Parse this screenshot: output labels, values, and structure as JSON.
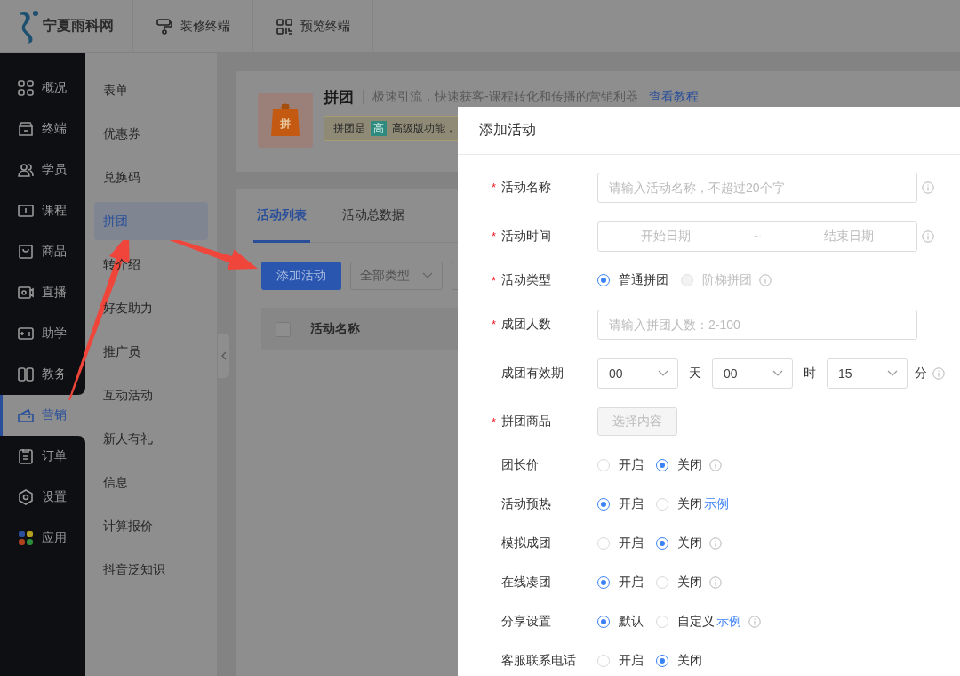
{
  "topbar": {
    "logo_text": "宁夏雨科网",
    "tabs": [
      {
        "label": "装修终端"
      },
      {
        "label": "预览终端"
      }
    ]
  },
  "nav": [
    {
      "label": "概况",
      "selected": false
    },
    {
      "label": "终端",
      "selected": false
    },
    {
      "label": "学员",
      "selected": false
    },
    {
      "label": "课程",
      "selected": false
    },
    {
      "label": "商品",
      "selected": false
    },
    {
      "label": "直播",
      "selected": false
    },
    {
      "label": "助学",
      "selected": false
    },
    {
      "label": "教务",
      "selected": false
    },
    {
      "label": "营销",
      "selected": true
    },
    {
      "label": "订单",
      "selected": false
    },
    {
      "label": "设置",
      "selected": false
    },
    {
      "label": "应用",
      "selected": false
    }
  ],
  "submenu": [
    {
      "label": "表单",
      "selected": false
    },
    {
      "label": "优惠券",
      "selected": false
    },
    {
      "label": "兑换码",
      "selected": false
    },
    {
      "label": "拼团",
      "selected": true
    },
    {
      "label": "转介绍",
      "selected": false
    },
    {
      "label": "好友助力",
      "selected": false
    },
    {
      "label": "推广员",
      "selected": false
    },
    {
      "label": "互动活动",
      "selected": false
    },
    {
      "label": "新人有礼",
      "selected": false
    },
    {
      "label": "信息",
      "selected": false
    },
    {
      "label": "计算报价",
      "selected": false
    },
    {
      "label": "抖音泛知识",
      "selected": false
    }
  ],
  "intro": {
    "icon_text": "拼",
    "title": "拼团",
    "subtitle": "极速引流，快速获客-课程转化和传播的营销利器",
    "link": "查看教程",
    "notice": {
      "prefix": "拼团是",
      "badge": "高",
      "text": "高级版功能，"
    }
  },
  "list": {
    "tabs": [
      {
        "label": "活动列表",
        "selected": true
      },
      {
        "label": "活动总数据",
        "selected": false
      }
    ],
    "add_button": "添加活动",
    "type_filter": "全部类型",
    "select_all": {
      "checked": false
    },
    "columns": [
      {
        "label": "活动名称"
      }
    ]
  },
  "drawer": {
    "title": "添加活动",
    "rows": [
      {
        "kind": "input",
        "required_mark": "*",
        "label": "活动名称",
        "placeholder": "请输入活动名称，不超过20个字",
        "info": true
      },
      {
        "kind": "daterange",
        "required_mark": "*",
        "label": "活动时间",
        "start": "开始日期",
        "sep": "~",
        "end": "结束日期",
        "info": true
      },
      {
        "kind": "radio",
        "required_mark": "*",
        "label": "活动类型",
        "options": [
          {
            "label": "普通拼团",
            "selected": true,
            "disabled": false
          },
          {
            "label": "阶梯拼团",
            "selected": false,
            "disabled": true
          }
        ],
        "info": true
      },
      {
        "kind": "input",
        "required_mark": "*",
        "label": "成团人数",
        "placeholder": "请输入拼团人数：2-100"
      },
      {
        "kind": "duration",
        "label": "成团有效期",
        "fields": [
          {
            "value": "00",
            "unit": "天"
          },
          {
            "value": "00",
            "unit": "时"
          },
          {
            "value": "15",
            "unit": "分"
          }
        ],
        "info": true
      },
      {
        "kind": "button",
        "required_mark": "*",
        "label": "拼团商品",
        "button": "选择内容"
      },
      {
        "kind": "radio",
        "label": "团长价",
        "options": [
          {
            "label": "开启",
            "selected": false,
            "disabled": false
          },
          {
            "label": "关闭",
            "selected": true,
            "disabled": false
          }
        ],
        "info": true
      },
      {
        "kind": "radio",
        "label": "活动预热",
        "options": [
          {
            "label": "开启",
            "selected": true,
            "disabled": false
          },
          {
            "label": "关闭",
            "selected": false,
            "disabled": false
          }
        ],
        "link": "示例"
      },
      {
        "kind": "radio",
        "label": "模拟成团",
        "options": [
          {
            "label": "开启",
            "selected": false,
            "disabled": false
          },
          {
            "label": "关闭",
            "selected": true,
            "disabled": false
          }
        ],
        "info": true
      },
      {
        "kind": "radio",
        "label": "在线凑团",
        "options": [
          {
            "label": "开启",
            "selected": true,
            "disabled": false
          },
          {
            "label": "关闭",
            "selected": false,
            "disabled": false
          }
        ],
        "info": true
      },
      {
        "kind": "radio",
        "label": "分享设置",
        "options": [
          {
            "label": "默认",
            "selected": true,
            "disabled": false
          },
          {
            "label": "自定义",
            "selected": false,
            "disabled": false
          }
        ],
        "link": "示例",
        "info": true
      },
      {
        "kind": "radio",
        "label": "客服联系电话",
        "options": [
          {
            "label": "开启",
            "selected": false,
            "disabled": false
          },
          {
            "label": "关闭",
            "selected": true,
            "disabled": false
          }
        ]
      }
    ]
  }
}
